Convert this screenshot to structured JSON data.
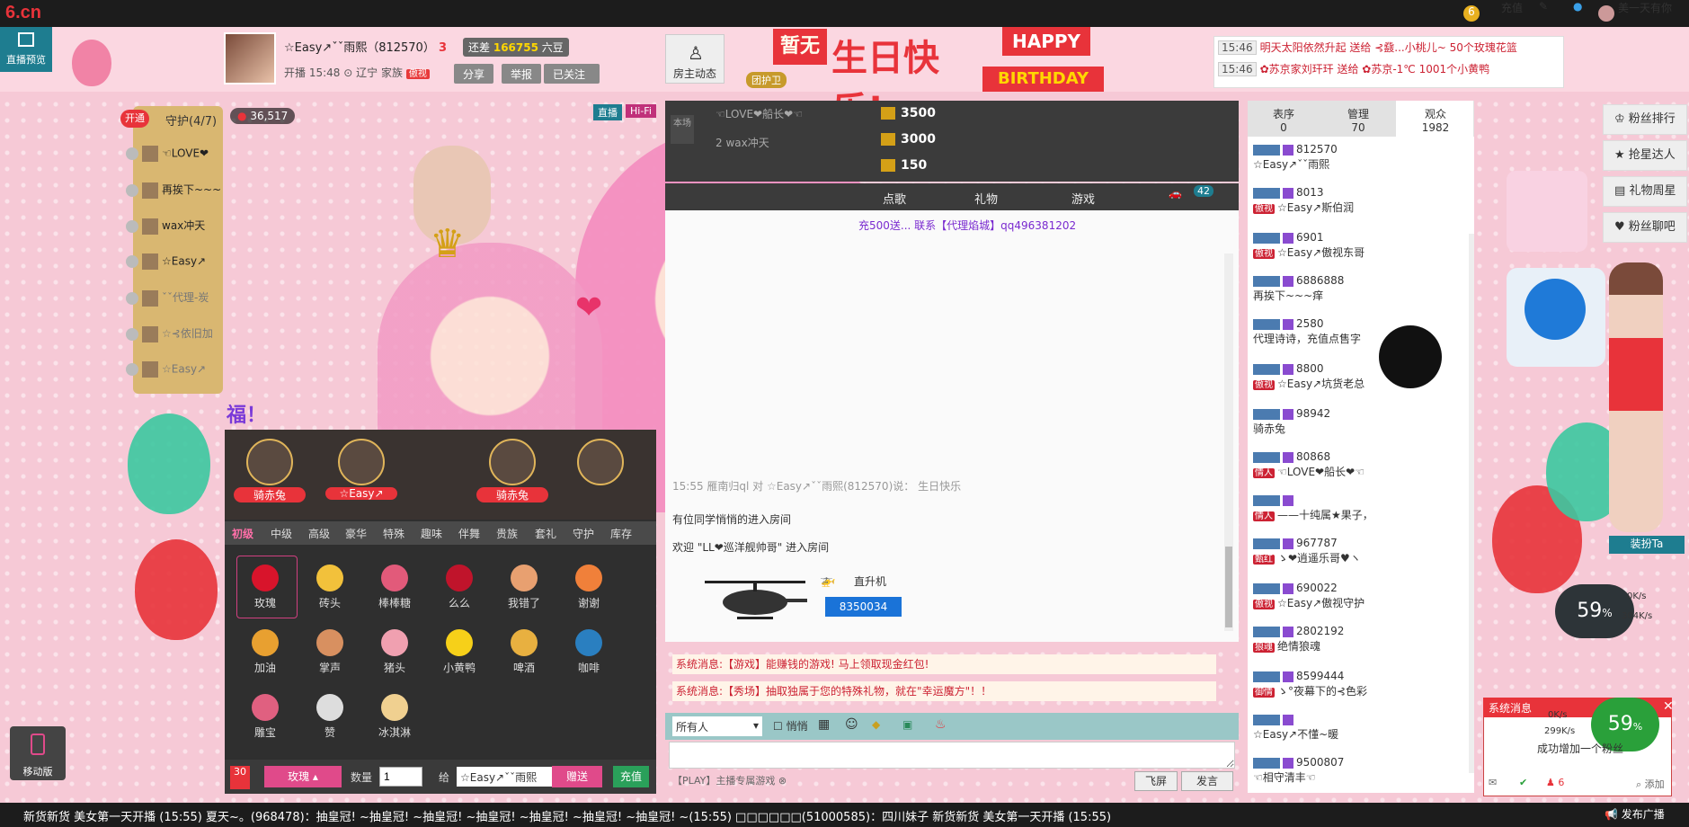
{
  "top": {
    "logo": "6.cn",
    "coins": "6",
    "recharge": "充值",
    "user": "美一天有你"
  },
  "header": {
    "live_preview": "直播预览",
    "host_name": "☆Easy↗ˇˇ雨熙（812570）",
    "level": "3",
    "balance_prefix": "还差",
    "balance_value": "166755",
    "balance_suffix": "六豆",
    "start_label": "开播",
    "start_time": "15:48",
    "location": "辽宁",
    "family_label": "家族",
    "family_tag": "傲视",
    "share": "分享",
    "report": "举报",
    "followed": "已关注",
    "owner_dynamic": "房主动态",
    "guard_badge": "团护卫",
    "banner_text": "暂无",
    "birthday_cn": "生日快乐!",
    "happy": "HAPPY",
    "birthday": "BIRTHDAY"
  },
  "gift_news": [
    {
      "time": "15:46",
      "text": "明天太阳依然升起 送给 ⊰鼗...小桃儿~ 50个玫瑰花篮"
    },
    {
      "time": "15:46",
      "text": "✿苏京家刘玕玕 送给 ✿苏京-1℃ 1001个小黄鸭"
    }
  ],
  "guard": {
    "open": "开通",
    "title": "守护(4/7)",
    "items": [
      "☜LOVE❤",
      "再挨下~~~",
      "wax冲天",
      "☆Easy↗",
      "ˇˇ代理-炭",
      "☆⊰依旧加",
      "☆Easy↗"
    ]
  },
  "video": {
    "view_count": "36,517",
    "live": "直播",
    "hifi": "Hi-Fi",
    "overlay_text": "福！"
  },
  "seats": [
    "骑赤兔",
    "☆Easy↗",
    "骑赤兔",
    ""
  ],
  "gift_tabs": [
    "初级",
    "中级",
    "高级",
    "豪华",
    "特殊",
    "趣味",
    "伴舞",
    "贵族",
    "套礼",
    "守护",
    "库存"
  ],
  "gifts": [
    {
      "name": "玫瑰",
      "color": "#d8142b"
    },
    {
      "name": "砖头",
      "color": "#f2c13b"
    },
    {
      "name": "棒棒糖",
      "color": "#e25a7a"
    },
    {
      "name": "么么",
      "color": "#c0142b"
    },
    {
      "name": "我错了",
      "color": "#e8a070"
    },
    {
      "name": "谢谢",
      "color": "#f0803a"
    },
    {
      "name": "加油",
      "color": "#e8a030"
    },
    {
      "name": "掌声",
      "color": "#d89060"
    },
    {
      "name": "猪头",
      "color": "#f0a0b0"
    },
    {
      "name": "小黄鸭",
      "color": "#f6d019"
    },
    {
      "name": "啤酒",
      "color": "#e8b040"
    },
    {
      "name": "咖啡",
      "color": "#2a7fc0"
    },
    {
      "name": "雕宝",
      "color": "#e06080"
    },
    {
      "name": "赞",
      "color": "#ddd"
    },
    {
      "name": "冰淇淋",
      "color": "#f0d090"
    }
  ],
  "gift_bar": {
    "badge": "30",
    "selected": "玫瑰",
    "qty_label": "数量",
    "qty": "1",
    "to_label": "给",
    "to_user": "☆Easy↗ˇˇ雨熙",
    "give": "赠送",
    "recharge": "充值"
  },
  "rank": [
    {
      "badge": "",
      "name": "☜LOVE❤船长❤☜",
      "value": "3500"
    },
    {
      "badge": "2",
      "name": "wax冲天",
      "value": "3000"
    },
    {
      "badge": "",
      "name": "",
      "value": "150"
    }
  ],
  "rank_label": "本场",
  "mid_tabs": [
    "点歌",
    "礼物",
    "游戏"
  ],
  "car_count": "42",
  "chat": {
    "top_line": "充500送... 联系【代理焰城】qq496381202",
    "gift_line": "15:55  雁南归ql 对 ☆Easy↗ˇˇ雨熙(812570)说：  生日快乐",
    "enter_anon": "有位同学悄悄的进入房间",
    "welcome": "欢迎 \"LL❤巡洋舰帅哥\" 进入房间",
    "heli_name": "直升机",
    "gift_no": "8350034",
    "sys1": "系统消息:【游戏】能赚钱的游戏! 马上领取现金红包!",
    "sys2": "系统消息:【秀场】抽取独属于您的特殊礼物，就在\"幸运魔方\"！！"
  },
  "input": {
    "target": "所有人",
    "whisper": "悄悄",
    "play": "【PLAY】主播专属游戏",
    "fly": "飞屏",
    "send": "发言"
  },
  "user_tabs": [
    {
      "label": "表序",
      "count": "0"
    },
    {
      "label": "管理",
      "count": "70"
    },
    {
      "label": "观众",
      "count": "1982"
    }
  ],
  "users": [
    {
      "id": "812570",
      "name": "☆Easy↗ˇˇ雨熙",
      "tag": ""
    },
    {
      "id": "8013",
      "name": "☆Easy↗斯伯润",
      "tag": "傲视"
    },
    {
      "id": "6901",
      "name": "☆Easy↗傲视东哥",
      "tag": "傲视"
    },
    {
      "id": "6886888",
      "name": "再挨下~~~痒",
      "tag": ""
    },
    {
      "id": "2580",
      "name": "代理诗诗，充值点售字",
      "tag": ""
    },
    {
      "id": "8800",
      "name": "☆Easy↗坑货老总",
      "tag": "傲视"
    },
    {
      "id": "98942",
      "name": "骑赤兔",
      "tag": ""
    },
    {
      "id": "80868",
      "name": "☜LOVE❤船长❤☜",
      "tag": "情人"
    },
    {
      "id": "",
      "name": "——十纯属★果子，",
      "tag": "情人"
    },
    {
      "id": "967787",
      "name": "ゝ❤逍遥乐哥♥ヽ",
      "tag": "甄红"
    },
    {
      "id": "690022",
      "name": "☆Easy↗傲视守护",
      "tag": "傲视"
    },
    {
      "id": "2802192",
      "name": "绝情狼魂",
      "tag": "狼魂"
    },
    {
      "id": "8599444",
      "name": "ゝ°夜幕下的⊰色彩",
      "tag": "御情"
    },
    {
      "id": "",
      "name": "☆Easy↗不懂~暖",
      "tag": ""
    },
    {
      "id": "9500807",
      "name": "☜相守清丰☜",
      "tag": ""
    }
  ],
  "side": {
    "fans_rank": "粉丝排行",
    "grab_star": "抢星达人",
    "gift_week": "礼物周星",
    "fans_talk": "粉丝聊吧",
    "dress": "装扮Ta"
  },
  "speed": {
    "percent": "59",
    "unit": "%",
    "up": "0K/s",
    "down": "304K/s"
  },
  "sysmsg": {
    "title": "系统消息",
    "text": "成功增加一个粉丝",
    "pct": "59",
    "up": "0K/s",
    "down": "299K/s",
    "count": "6",
    "add": "添加"
  },
  "mobile": "移动版",
  "ticker": "新货新货 美女第一天开播    (15:55)  夏天~。(968478)：抽皇冠! ~抽皇冠! ~抽皇冠! ~抽皇冠! ~抽皇冠! ~抽皇冠! ~抽皇冠! ~(15:55)   □□□□□□(51000585)：四川妹子 新货新货 美女第一天开播    (15:55)",
  "broadcast": "发布广播"
}
